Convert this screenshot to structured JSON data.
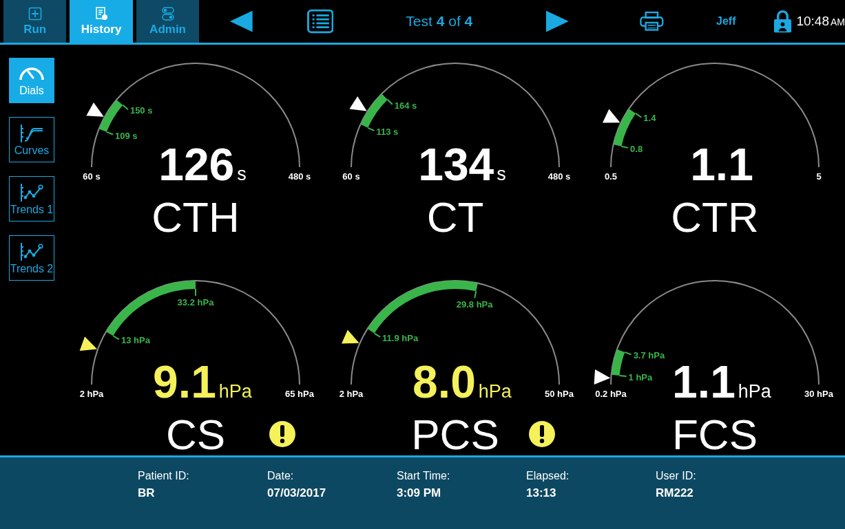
{
  "tabs": [
    {
      "label": "Run",
      "selected": false
    },
    {
      "label": "History",
      "selected": true
    },
    {
      "label": "Admin",
      "selected": false
    }
  ],
  "navigator": {
    "label": "Test **4** of **4**"
  },
  "user": "Jeff",
  "clock": {
    "time": "10:48",
    "meridiem": "AM"
  },
  "views": [
    {
      "label": "Dials",
      "selected": true
    },
    {
      "label": "Curves",
      "selected": false
    },
    {
      "label": "Trends 1",
      "selected": false
    },
    {
      "label": "Trends 2",
      "selected": false
    }
  ],
  "gauges": [
    {
      "name": "CTH",
      "value": "126",
      "unit": "s",
      "min_label": "60 s",
      "max_label": "480 s",
      "warning": false,
      "pointer": {
        "level": 0.16
      },
      "range": {
        "low": {
          "label": "109 s",
          "level": 0.12
        },
        "high": {
          "label": "150 s",
          "level": 0.225
        }
      }
    },
    {
      "name": "CT",
      "value": "134",
      "unit": "s",
      "min_label": "60 s",
      "max_label": "480 s",
      "warning": false,
      "pointer": {
        "level": 0.18
      },
      "range": {
        "low": {
          "label": "113 s",
          "level": 0.135
        },
        "high": {
          "label": "164 s",
          "level": 0.25
        }
      }
    },
    {
      "name": "CTR",
      "value": "1.1",
      "min_label": "0.5",
      "max_label": "5",
      "warning": false,
      "pointer": {
        "level": 0.14
      },
      "range": {
        "low": {
          "label": "0.8",
          "level": 0.07
        },
        "high": {
          "label": "1.4",
          "level": 0.19
        }
      }
    },
    {
      "name": "CS",
      "value": "9.1",
      "unit": "hPa",
      "min_label": "2 hPa",
      "max_label": "65 hPa",
      "warning": true,
      "pointer": {
        "level": 0.11
      },
      "range": {
        "low": {
          "label": "13 hPa",
          "level": 0.17
        },
        "high": {
          "label": "33.2 hPa",
          "level": 0.5
        }
      }
    },
    {
      "name": "PCS",
      "value": "8.0",
      "unit": "hPa",
      "min_label": "2 hPa",
      "max_label": "50 hPa",
      "warning": true,
      "pointer": {
        "level": 0.13
      },
      "range": {
        "low": {
          "label": "11.9 hPa",
          "level": 0.18
        },
        "high": {
          "label": "29.8 hPa",
          "level": 0.57
        }
      }
    },
    {
      "name": "FCS",
      "value": "1.1",
      "unit": "hPa",
      "min_label": "0.2 hPa",
      "max_label": "30 hPa",
      "warning": false,
      "pointer": {
        "level": 0.02
      },
      "range": {
        "low": {
          "label": "1 hPa",
          "level": 0.03
        },
        "high": {
          "label": "3.7 hPa",
          "level": 0.11
        }
      }
    }
  ],
  "footer": [
    {
      "label": "Patient ID:",
      "value": "BR"
    },
    {
      "label": "Date:",
      "value": "07/03/2017"
    },
    {
      "label": "Start Time:",
      "value": "3:09 PM"
    },
    {
      "label": "Elapsed:",
      "value": "13:13"
    },
    {
      "label": "User ID:",
      "value": "RM222"
    }
  ]
}
